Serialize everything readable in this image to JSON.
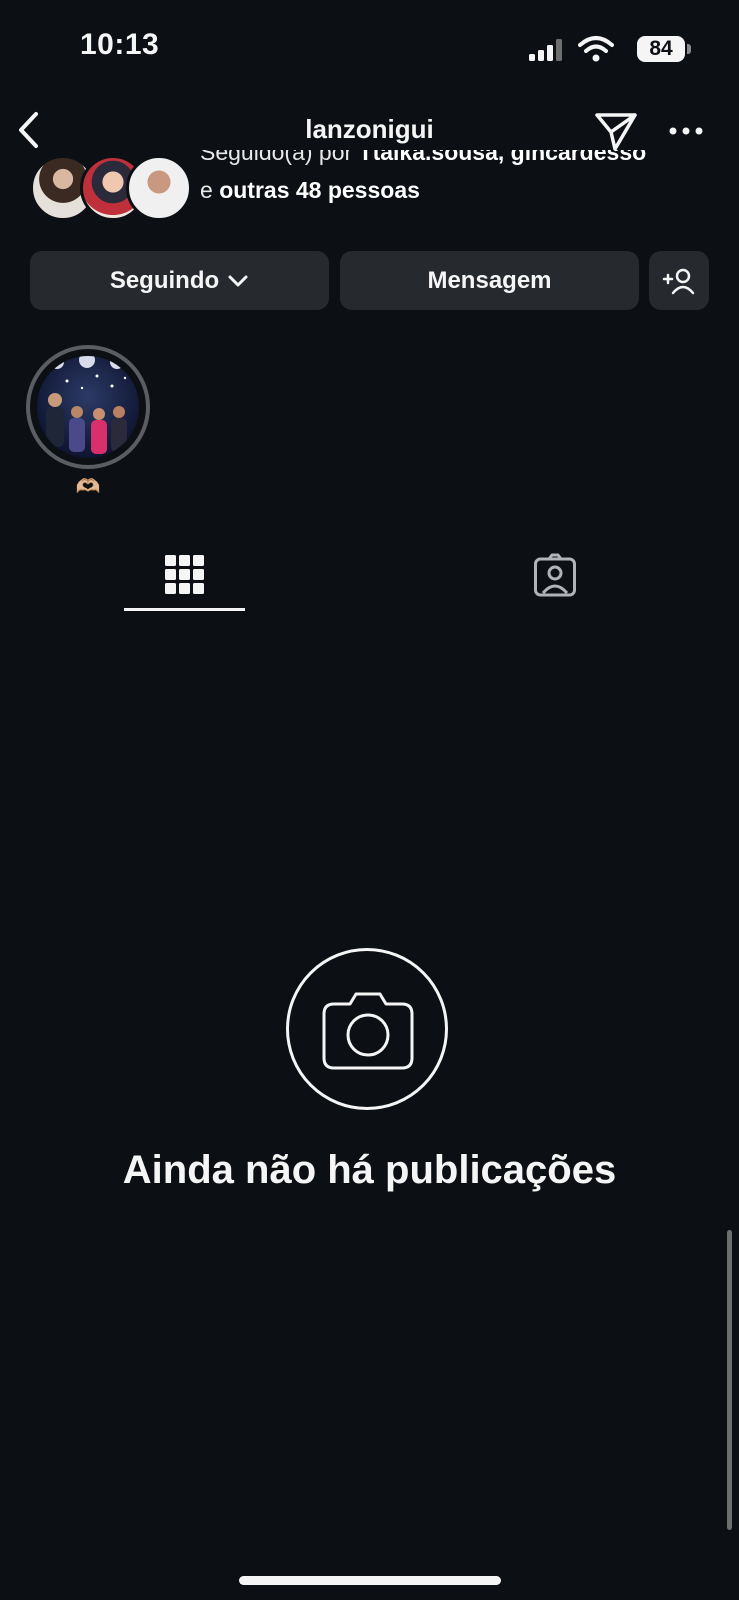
{
  "status_bar": {
    "time": "10:13",
    "battery": "84"
  },
  "header": {
    "username": "lanzonigui"
  },
  "followed_by": {
    "prefix": "Seguido(a) por ",
    "names": "Ttaika.sousa, gincardesso",
    "line2_prefix": "e ",
    "line2_bold": "outras 48 pessoas"
  },
  "actions": {
    "following_label": "Seguindo",
    "message_label": "Mensagem"
  },
  "highlights": [
    {
      "label": "🫶🏼"
    }
  ],
  "empty_state": {
    "title": "Ainda não há publicações"
  },
  "colors": {
    "background": "#0c1014",
    "button": "#262a2f",
    "text": "#f5f5f5"
  }
}
